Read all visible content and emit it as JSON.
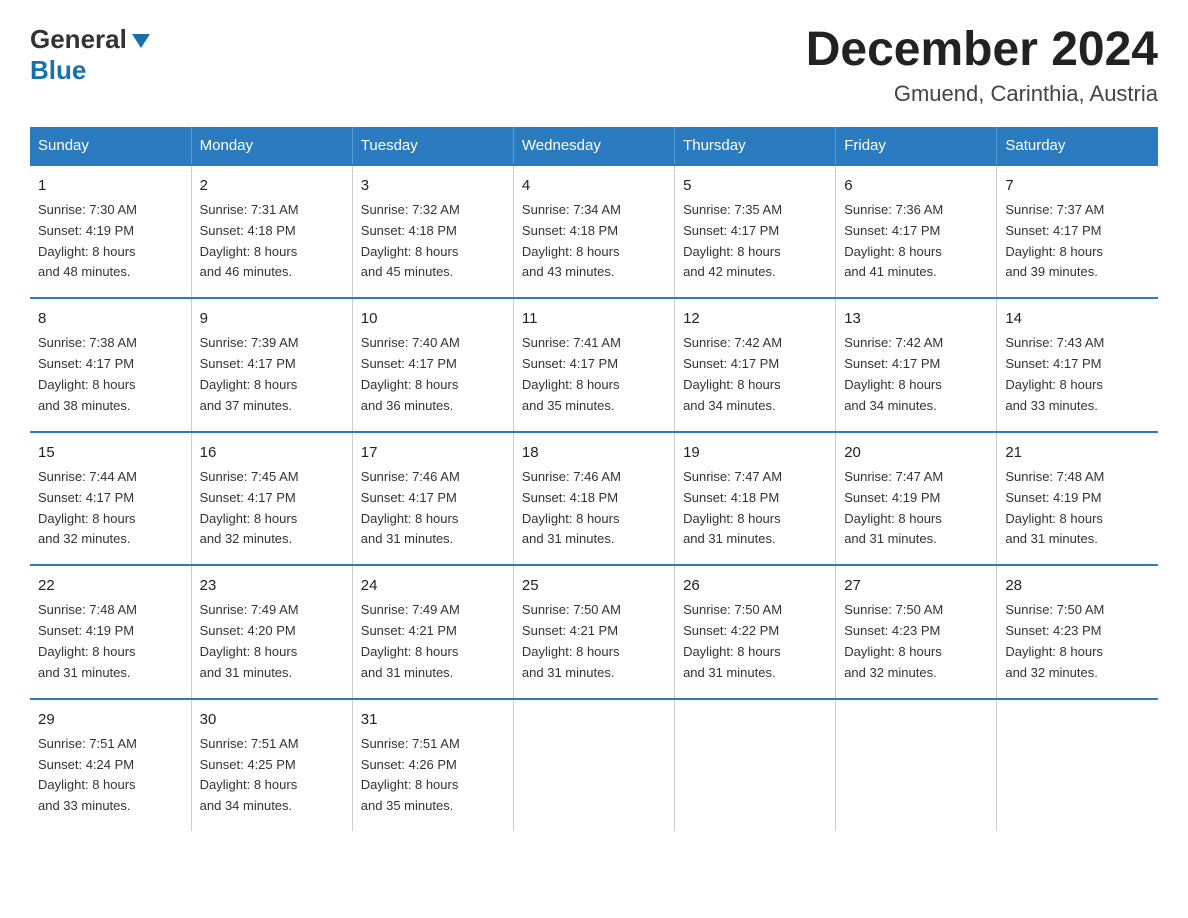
{
  "header": {
    "logo_general": "General",
    "logo_blue": "Blue",
    "month_title": "December 2024",
    "location": "Gmuend, Carinthia, Austria"
  },
  "calendar": {
    "days_of_week": [
      "Sunday",
      "Monday",
      "Tuesday",
      "Wednesday",
      "Thursday",
      "Friday",
      "Saturday"
    ],
    "weeks": [
      [
        {
          "day": "1",
          "sunrise": "Sunrise: 7:30 AM",
          "sunset": "Sunset: 4:19 PM",
          "daylight": "Daylight: 8 hours",
          "daylight2": "and 48 minutes."
        },
        {
          "day": "2",
          "sunrise": "Sunrise: 7:31 AM",
          "sunset": "Sunset: 4:18 PM",
          "daylight": "Daylight: 8 hours",
          "daylight2": "and 46 minutes."
        },
        {
          "day": "3",
          "sunrise": "Sunrise: 7:32 AM",
          "sunset": "Sunset: 4:18 PM",
          "daylight": "Daylight: 8 hours",
          "daylight2": "and 45 minutes."
        },
        {
          "day": "4",
          "sunrise": "Sunrise: 7:34 AM",
          "sunset": "Sunset: 4:18 PM",
          "daylight": "Daylight: 8 hours",
          "daylight2": "and 43 minutes."
        },
        {
          "day": "5",
          "sunrise": "Sunrise: 7:35 AM",
          "sunset": "Sunset: 4:17 PM",
          "daylight": "Daylight: 8 hours",
          "daylight2": "and 42 minutes."
        },
        {
          "day": "6",
          "sunrise": "Sunrise: 7:36 AM",
          "sunset": "Sunset: 4:17 PM",
          "daylight": "Daylight: 8 hours",
          "daylight2": "and 41 minutes."
        },
        {
          "day": "7",
          "sunrise": "Sunrise: 7:37 AM",
          "sunset": "Sunset: 4:17 PM",
          "daylight": "Daylight: 8 hours",
          "daylight2": "and 39 minutes."
        }
      ],
      [
        {
          "day": "8",
          "sunrise": "Sunrise: 7:38 AM",
          "sunset": "Sunset: 4:17 PM",
          "daylight": "Daylight: 8 hours",
          "daylight2": "and 38 minutes."
        },
        {
          "day": "9",
          "sunrise": "Sunrise: 7:39 AM",
          "sunset": "Sunset: 4:17 PM",
          "daylight": "Daylight: 8 hours",
          "daylight2": "and 37 minutes."
        },
        {
          "day": "10",
          "sunrise": "Sunrise: 7:40 AM",
          "sunset": "Sunset: 4:17 PM",
          "daylight": "Daylight: 8 hours",
          "daylight2": "and 36 minutes."
        },
        {
          "day": "11",
          "sunrise": "Sunrise: 7:41 AM",
          "sunset": "Sunset: 4:17 PM",
          "daylight": "Daylight: 8 hours",
          "daylight2": "and 35 minutes."
        },
        {
          "day": "12",
          "sunrise": "Sunrise: 7:42 AM",
          "sunset": "Sunset: 4:17 PM",
          "daylight": "Daylight: 8 hours",
          "daylight2": "and 34 minutes."
        },
        {
          "day": "13",
          "sunrise": "Sunrise: 7:42 AM",
          "sunset": "Sunset: 4:17 PM",
          "daylight": "Daylight: 8 hours",
          "daylight2": "and 34 minutes."
        },
        {
          "day": "14",
          "sunrise": "Sunrise: 7:43 AM",
          "sunset": "Sunset: 4:17 PM",
          "daylight": "Daylight: 8 hours",
          "daylight2": "and 33 minutes."
        }
      ],
      [
        {
          "day": "15",
          "sunrise": "Sunrise: 7:44 AM",
          "sunset": "Sunset: 4:17 PM",
          "daylight": "Daylight: 8 hours",
          "daylight2": "and 32 minutes."
        },
        {
          "day": "16",
          "sunrise": "Sunrise: 7:45 AM",
          "sunset": "Sunset: 4:17 PM",
          "daylight": "Daylight: 8 hours",
          "daylight2": "and 32 minutes."
        },
        {
          "day": "17",
          "sunrise": "Sunrise: 7:46 AM",
          "sunset": "Sunset: 4:17 PM",
          "daylight": "Daylight: 8 hours",
          "daylight2": "and 31 minutes."
        },
        {
          "day": "18",
          "sunrise": "Sunrise: 7:46 AM",
          "sunset": "Sunset: 4:18 PM",
          "daylight": "Daylight: 8 hours",
          "daylight2": "and 31 minutes."
        },
        {
          "day": "19",
          "sunrise": "Sunrise: 7:47 AM",
          "sunset": "Sunset: 4:18 PM",
          "daylight": "Daylight: 8 hours",
          "daylight2": "and 31 minutes."
        },
        {
          "day": "20",
          "sunrise": "Sunrise: 7:47 AM",
          "sunset": "Sunset: 4:19 PM",
          "daylight": "Daylight: 8 hours",
          "daylight2": "and 31 minutes."
        },
        {
          "day": "21",
          "sunrise": "Sunrise: 7:48 AM",
          "sunset": "Sunset: 4:19 PM",
          "daylight": "Daylight: 8 hours",
          "daylight2": "and 31 minutes."
        }
      ],
      [
        {
          "day": "22",
          "sunrise": "Sunrise: 7:48 AM",
          "sunset": "Sunset: 4:19 PM",
          "daylight": "Daylight: 8 hours",
          "daylight2": "and 31 minutes."
        },
        {
          "day": "23",
          "sunrise": "Sunrise: 7:49 AM",
          "sunset": "Sunset: 4:20 PM",
          "daylight": "Daylight: 8 hours",
          "daylight2": "and 31 minutes."
        },
        {
          "day": "24",
          "sunrise": "Sunrise: 7:49 AM",
          "sunset": "Sunset: 4:21 PM",
          "daylight": "Daylight: 8 hours",
          "daylight2": "and 31 minutes."
        },
        {
          "day": "25",
          "sunrise": "Sunrise: 7:50 AM",
          "sunset": "Sunset: 4:21 PM",
          "daylight": "Daylight: 8 hours",
          "daylight2": "and 31 minutes."
        },
        {
          "day": "26",
          "sunrise": "Sunrise: 7:50 AM",
          "sunset": "Sunset: 4:22 PM",
          "daylight": "Daylight: 8 hours",
          "daylight2": "and 31 minutes."
        },
        {
          "day": "27",
          "sunrise": "Sunrise: 7:50 AM",
          "sunset": "Sunset: 4:23 PM",
          "daylight": "Daylight: 8 hours",
          "daylight2": "and 32 minutes."
        },
        {
          "day": "28",
          "sunrise": "Sunrise: 7:50 AM",
          "sunset": "Sunset: 4:23 PM",
          "daylight": "Daylight: 8 hours",
          "daylight2": "and 32 minutes."
        }
      ],
      [
        {
          "day": "29",
          "sunrise": "Sunrise: 7:51 AM",
          "sunset": "Sunset: 4:24 PM",
          "daylight": "Daylight: 8 hours",
          "daylight2": "and 33 minutes."
        },
        {
          "day": "30",
          "sunrise": "Sunrise: 7:51 AM",
          "sunset": "Sunset: 4:25 PM",
          "daylight": "Daylight: 8 hours",
          "daylight2": "and 34 minutes."
        },
        {
          "day": "31",
          "sunrise": "Sunrise: 7:51 AM",
          "sunset": "Sunset: 4:26 PM",
          "daylight": "Daylight: 8 hours",
          "daylight2": "and 35 minutes."
        },
        {
          "day": "",
          "sunrise": "",
          "sunset": "",
          "daylight": "",
          "daylight2": ""
        },
        {
          "day": "",
          "sunrise": "",
          "sunset": "",
          "daylight": "",
          "daylight2": ""
        },
        {
          "day": "",
          "sunrise": "",
          "sunset": "",
          "daylight": "",
          "daylight2": ""
        },
        {
          "day": "",
          "sunrise": "",
          "sunset": "",
          "daylight": "",
          "daylight2": ""
        }
      ]
    ]
  }
}
